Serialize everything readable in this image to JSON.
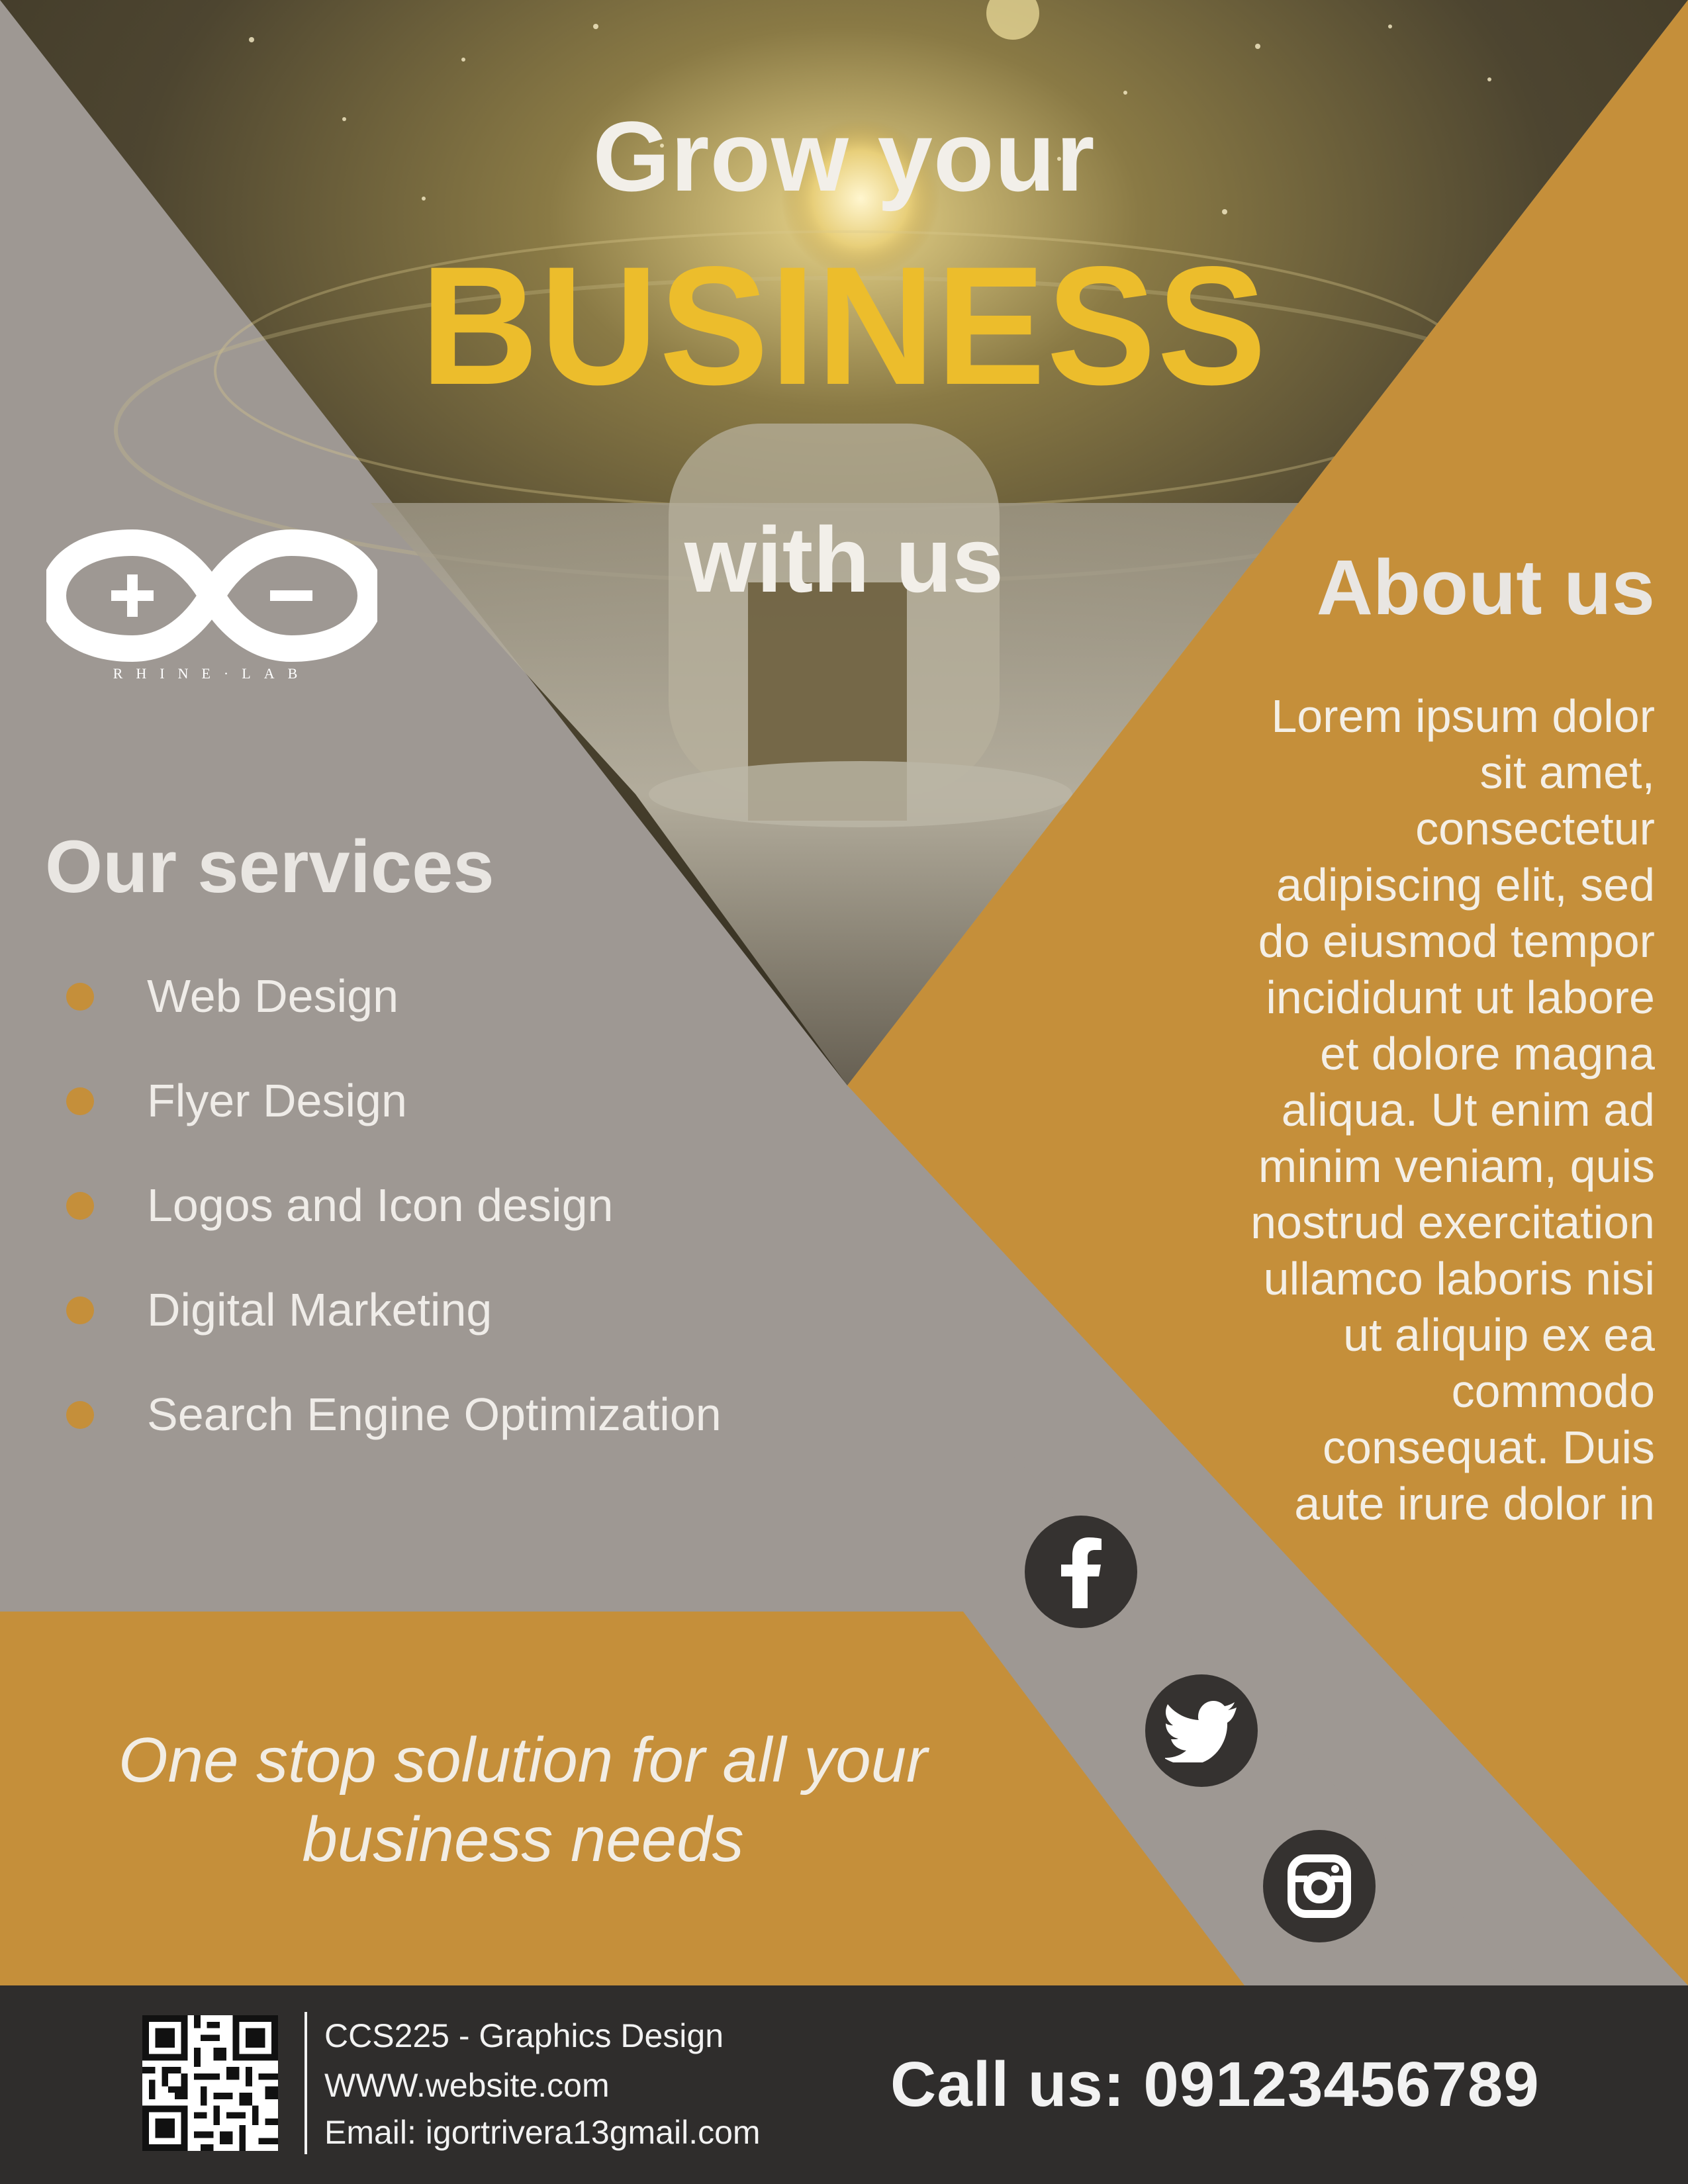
{
  "hero": {
    "line1": "Grow your",
    "line2": "BUSINESS",
    "line3": "with us"
  },
  "logo": {
    "icon": "infinity-plus-minus-logo",
    "text": "RHINE·LAB"
  },
  "services": {
    "title": "Our services",
    "items": [
      {
        "label": "Web Design"
      },
      {
        "label": "Flyer Design"
      },
      {
        "label": "Logos and Icon design"
      },
      {
        "label": "Digital Marketing"
      },
      {
        "label": "Search Engine Optimization"
      }
    ]
  },
  "about": {
    "title": "About us",
    "lines": [
      "Lorem ipsum dolor",
      "sit amet,",
      "consectetur",
      "adipiscing elit, sed",
      "do eiusmod tempor",
      "incididunt ut labore",
      "et dolore magna",
      "aliqua. Ut enim ad",
      "minim veniam, quis",
      "nostrud exercitation",
      "ullamco laboris nisi",
      "ut aliquip ex ea",
      "commodo",
      "consequat. Duis",
      "aute irure dolor in"
    ]
  },
  "tagline": {
    "line1": "One stop solution for all your",
    "line2": "business needs"
  },
  "social": [
    {
      "icon": "facebook-icon"
    },
    {
      "icon": "twitter-icon"
    },
    {
      "icon": "instagram-icon"
    }
  ],
  "footer": {
    "course": "CCS225 - Graphics Design",
    "website": "WWW.website.com",
    "email": "Email: igortrivera13gmail.com",
    "call": "Call us: 09123456789",
    "qr_icon": "qr-code-icon"
  },
  "colors": {
    "gray": "#9e9893",
    "gold": "#c58f3a",
    "yellow": "#ecbd2c",
    "dark": "#2f2d2c",
    "white": "#f2efe9"
  }
}
